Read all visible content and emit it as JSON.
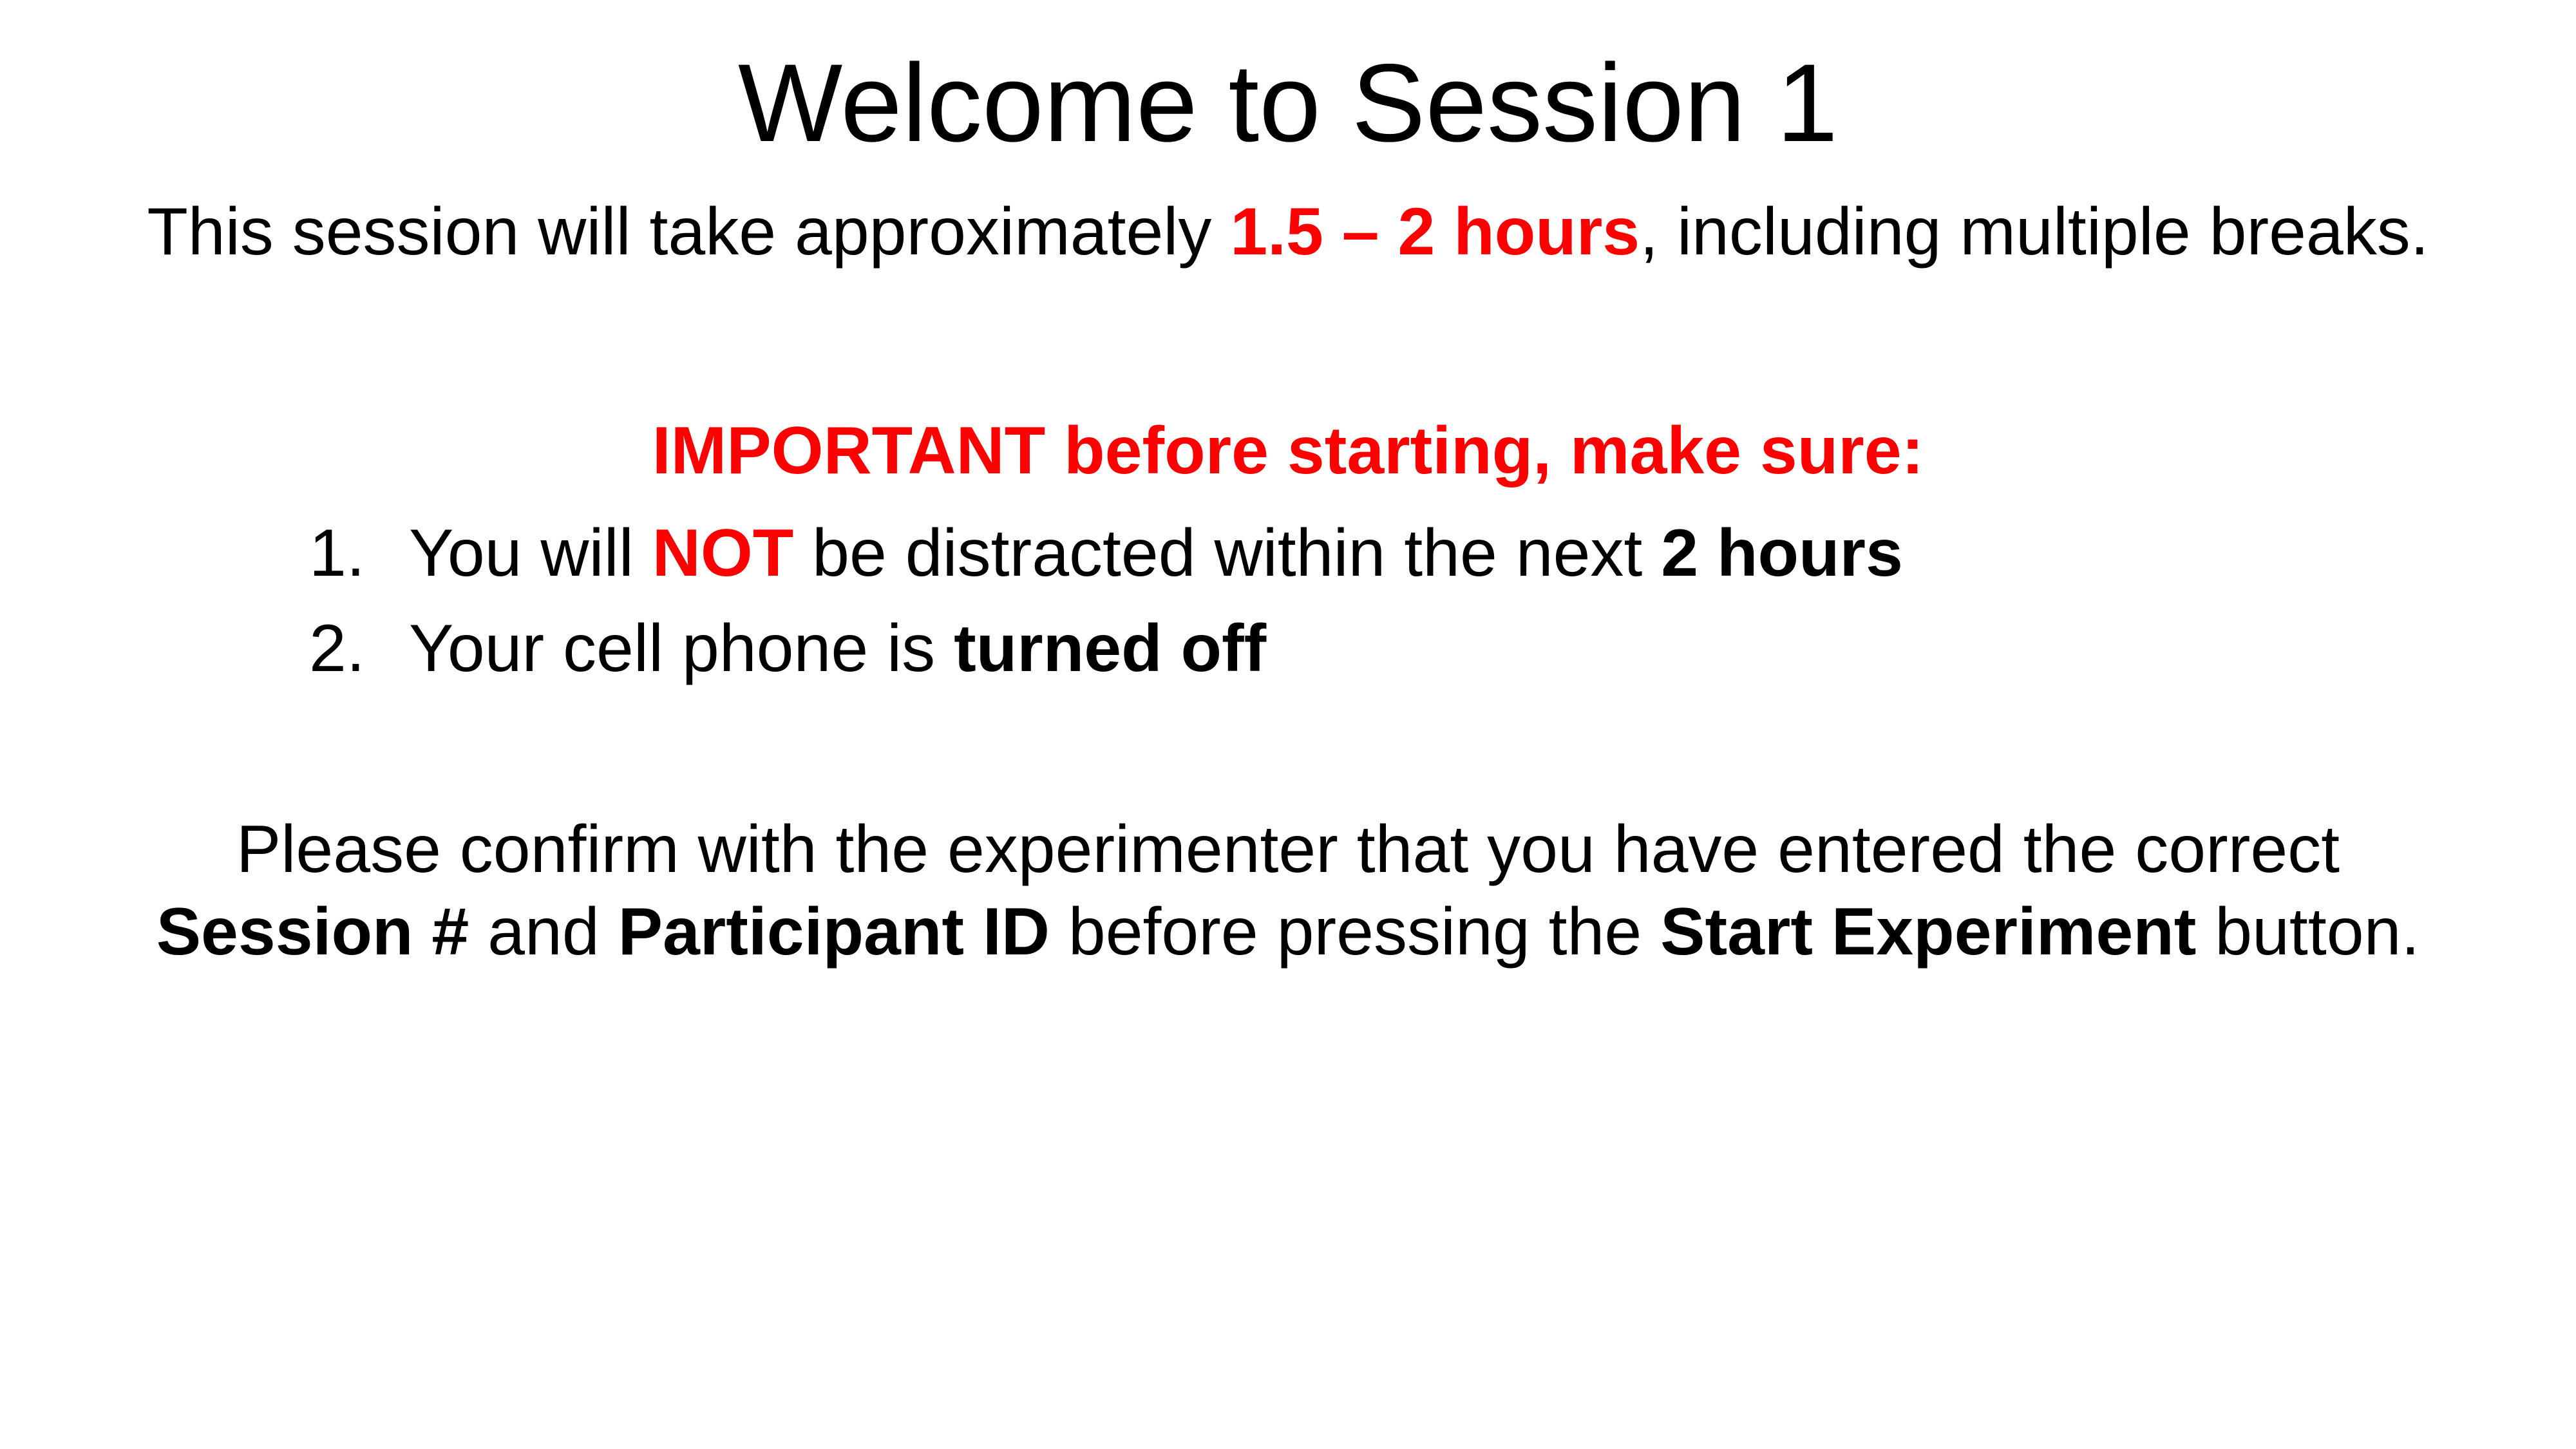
{
  "accent_color": "#ff0000",
  "title": "Welcome to Session 1",
  "subtitle": {
    "prefix": "This session will take approximately ",
    "duration": "1.5 – 2 hours",
    "suffix": ", including multiple breaks."
  },
  "important_heading": "IMPORTANT before starting, make sure:",
  "checklist": [
    {
      "number": "1.",
      "part1": "You will ",
      "emph_red": "NOT",
      "part2": " be distracted within the next ",
      "emph_bold": "2 hours"
    },
    {
      "number": "2.",
      "part1": "Your cell phone is ",
      "emph_bold": "turned off"
    }
  ],
  "confirmation": {
    "line1": "Please confirm with the experimenter that you have entered the correct",
    "session_label": "Session #",
    "and": " and ",
    "participant_label": "Participant ID",
    "before": " before pressing the ",
    "button_label": "Start Experiment",
    "end": " button."
  }
}
